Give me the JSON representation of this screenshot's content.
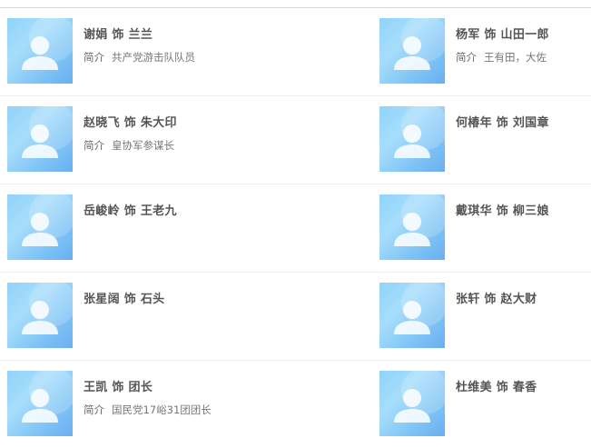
{
  "intro_label": "简介",
  "cast": [
    [
      {
        "name": "谢娟 饰 兰兰",
        "intro": "共产党游击队队员"
      },
      {
        "name": "杨军 饰 山田一郎",
        "intro": "王有田，大佐"
      }
    ],
    [
      {
        "name": "赵晓飞 饰 朱大印",
        "intro": "皇协军参谋长"
      },
      {
        "name": "何椿年 饰 刘国章",
        "intro": ""
      }
    ],
    [
      {
        "name": "岳峻岭 饰 王老九",
        "intro": ""
      },
      {
        "name": "戴琪华 饰 柳三娘",
        "intro": ""
      }
    ],
    [
      {
        "name": "张星阔 饰 石头",
        "intro": ""
      },
      {
        "name": "张轩 饰 赵大财",
        "intro": ""
      }
    ],
    [
      {
        "name": "王凯 饰 团长",
        "intro": "国民党17峪31团团长"
      },
      {
        "name": "杜维美 饰 春香",
        "intro": ""
      }
    ]
  ],
  "avatar_icon": "default-person-avatar-icon"
}
